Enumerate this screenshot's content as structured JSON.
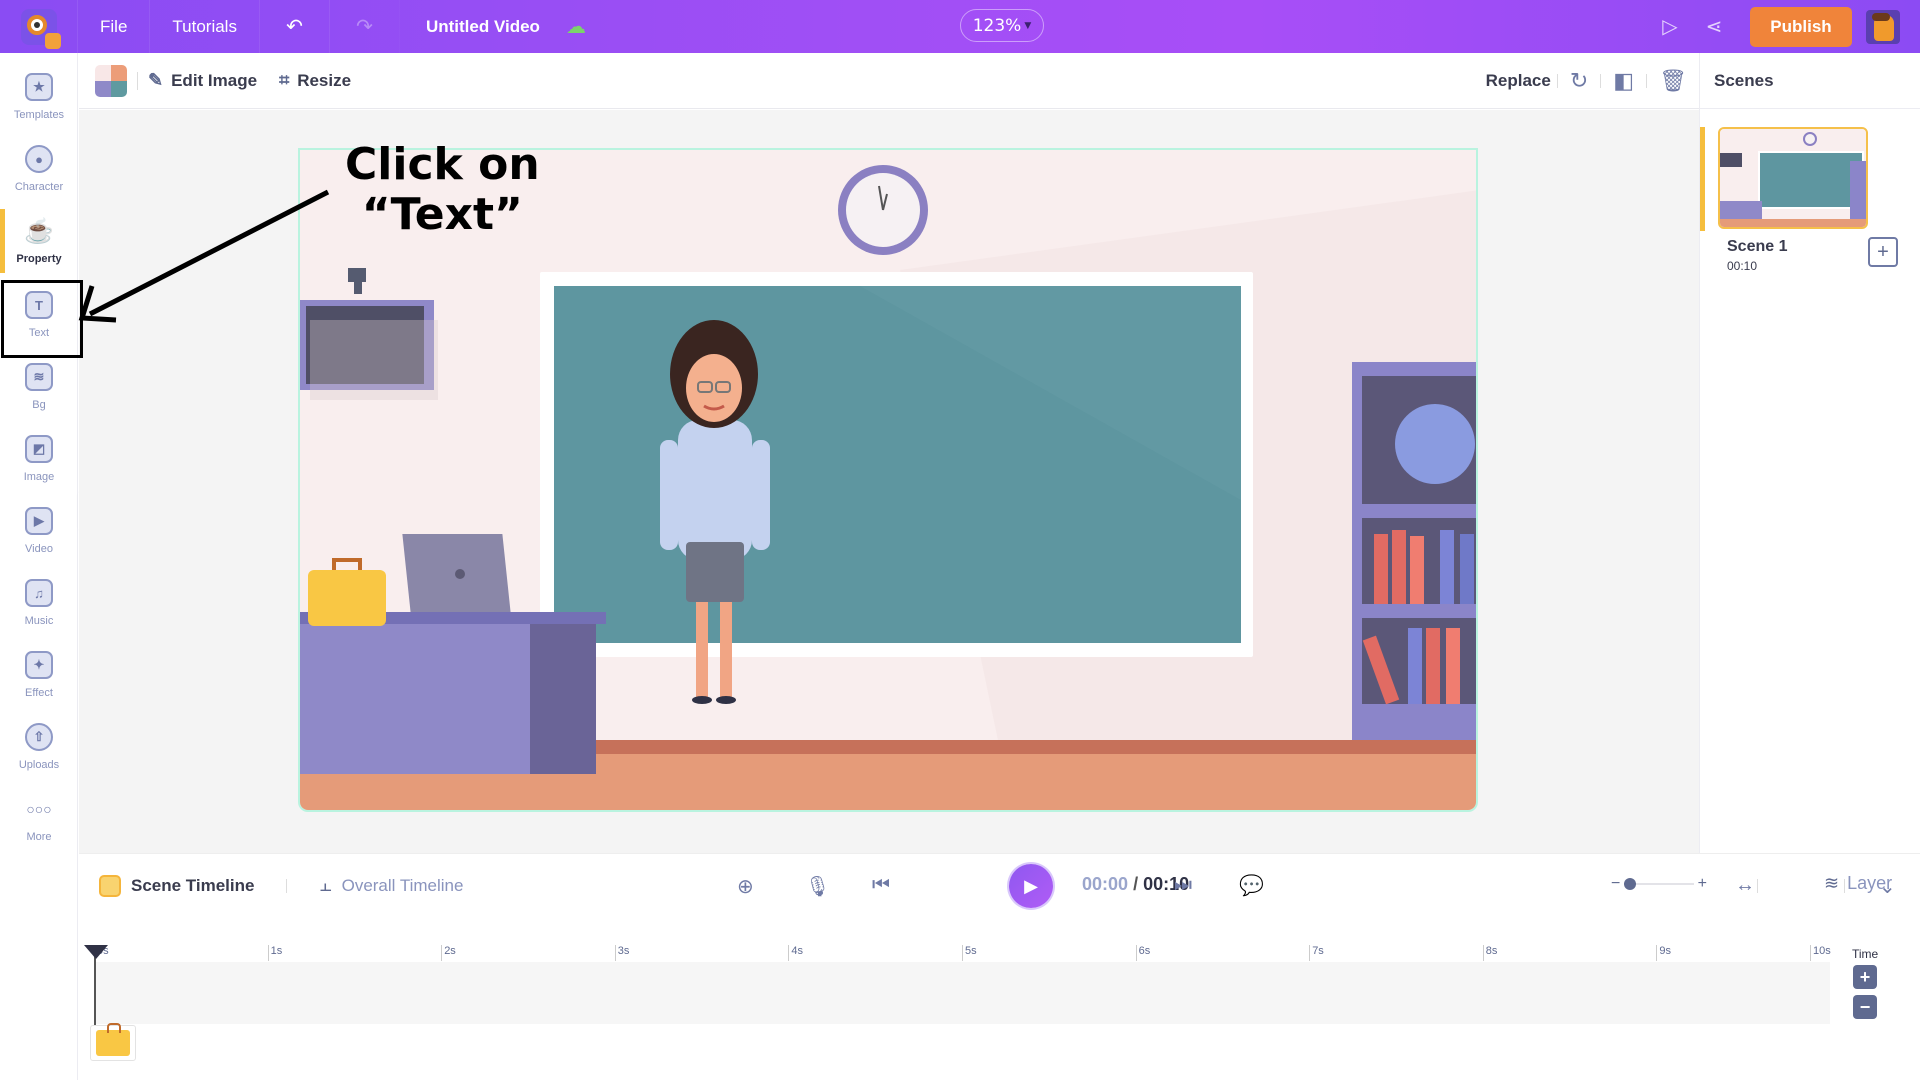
{
  "topbar": {
    "menu": [
      {
        "label": "File"
      },
      {
        "label": "Tutorials"
      }
    ],
    "undo_icon": "undo-icon",
    "redo_icon": "redo-icon",
    "title": "Untitled Video",
    "cloud_icon": "cloud-saved-icon",
    "zoom": "123%",
    "preview_icon": "play-preview-icon",
    "share_icon": "share-icon",
    "publish_label": "Publish"
  },
  "sidebar": {
    "items": [
      {
        "label": "Templates",
        "icon": "clapperboard-icon",
        "glyph": "★"
      },
      {
        "label": "Character",
        "icon": "person-icon",
        "glyph": "👤"
      },
      {
        "label": "Property",
        "icon": "coffee-cup-icon",
        "glyph": "☕",
        "active": true
      },
      {
        "label": "Text",
        "icon": "text-t-icon",
        "glyph": "T"
      },
      {
        "label": "Bg",
        "icon": "layers-bg-icon",
        "glyph": "≋"
      },
      {
        "label": "Image",
        "icon": "image-icon",
        "glyph": "◩"
      },
      {
        "label": "Video",
        "icon": "video-play-icon",
        "glyph": "▶"
      },
      {
        "label": "Music",
        "icon": "music-note-icon",
        "glyph": "♫"
      },
      {
        "label": "Effect",
        "icon": "sparkle-effect-icon",
        "glyph": "✦"
      },
      {
        "label": "Uploads",
        "icon": "cloud-upload-icon",
        "glyph": "⇧"
      },
      {
        "label": "More",
        "icon": "more-dots-icon",
        "glyph": "∘∘∘"
      }
    ]
  },
  "toolbar": {
    "edit_image_label": "Edit Image",
    "resize_label": "Resize",
    "replace_label": "Replace"
  },
  "annotation": {
    "line1": "Click on",
    "line2": "“Text”"
  },
  "scenes": {
    "title": "Scenes",
    "items": [
      {
        "name": "Scene 1",
        "duration": "00:10"
      }
    ]
  },
  "timeline": {
    "scene_tab": "Scene Timeline",
    "overall_tab": "Overall Timeline",
    "current_time": "00:00",
    "separator": "/",
    "total_time": "00:10",
    "layer_label": "Layer",
    "zoom_level": 0.0,
    "ticks": [
      "0s",
      "1s",
      "2s",
      "3s",
      "4s",
      "5s",
      "6s",
      "7s",
      "8s",
      "9s",
      "10s"
    ],
    "time_label": "Time",
    "time_plus": "+",
    "time_minus": "−"
  },
  "colors": {
    "brand_purple": "#9b4ef5",
    "publish_orange": "#f0843a",
    "active_yellow": "#f5be3d",
    "selection_mint": "#b9f3df"
  }
}
